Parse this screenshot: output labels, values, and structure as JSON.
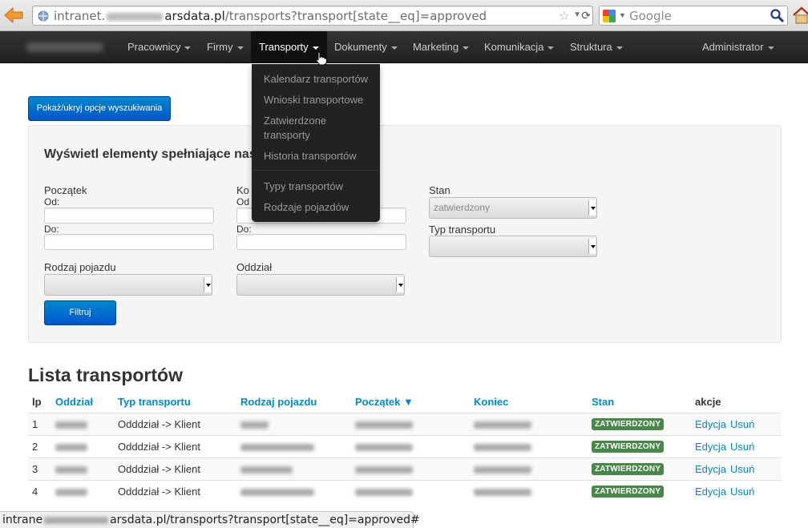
{
  "browser": {
    "url_host_start": "intranet.",
    "url_host_end": "arsdata.pl",
    "url_path": "/transports?transport[state__eq]=approved",
    "search_placeholder": "Google"
  },
  "nav": {
    "items": [
      {
        "label": "Pracownicy"
      },
      {
        "label": "Firmy"
      },
      {
        "label": "Transporty"
      },
      {
        "label": "Dokumenty"
      },
      {
        "label": "Marketing"
      },
      {
        "label": "Komunikacja"
      },
      {
        "label": "Struktura"
      }
    ],
    "user": "Administrator",
    "dropdown": [
      "Kalendarz transportów",
      "Wnioski transportowe",
      "Zatwierdzone transporty",
      "Historia transportów",
      "Typy transportów",
      "Rodzaje pojazdów"
    ]
  },
  "search": {
    "toggle_label": "Pokaż/ukryj opcje wyszukiwania",
    "title": "Wyświetl elementy spełniające nas",
    "start_label": "Początek",
    "end_label": "Ko",
    "from_label": "Od:",
    "from_label_short": "Od",
    "to_label": "Do:",
    "state_label": "Stan",
    "state_value": "zatwierdzony",
    "transport_type_label": "Typ transportu",
    "vehicle_label": "Rodzaj pojazdu",
    "branch_label": "Oddział",
    "filter_label": "Filtruj"
  },
  "list": {
    "title": "Lista transportów",
    "headers": {
      "lp": "lp",
      "branch": "Oddział",
      "type": "Typ transportu",
      "vehicle": "Rodzaj pojazdu",
      "start": "Początek ▼",
      "end": "Koniec",
      "state": "Stan",
      "actions": "akcje"
    },
    "rows": [
      {
        "lp": "1",
        "type": "Odddział -> Klient",
        "state": "ZATWIERDZONY",
        "edit": "Edycja",
        "delete": "Usuń"
      },
      {
        "lp": "2",
        "type": "Odddział -> Klient",
        "state": "ZATWIERDZONY",
        "edit": "Edycja",
        "delete": "Usuń"
      },
      {
        "lp": "3",
        "type": "Odddział -> Klient",
        "state": "ZATWIERDZONY",
        "edit": "Edycja",
        "delete": "Usuń"
      },
      {
        "lp": "4",
        "type": "Odddział -> Klient",
        "state": "ZATWIERDZONY",
        "edit": "Edycja",
        "delete": "Usuń"
      }
    ]
  },
  "status": {
    "start": "intrane",
    "end": "arsdata.pl/transports?transport[state__eq]=approved#"
  },
  "colors": {
    "navbar": "#222222",
    "primary": "#0088cc",
    "badge_success": "#468847"
  }
}
